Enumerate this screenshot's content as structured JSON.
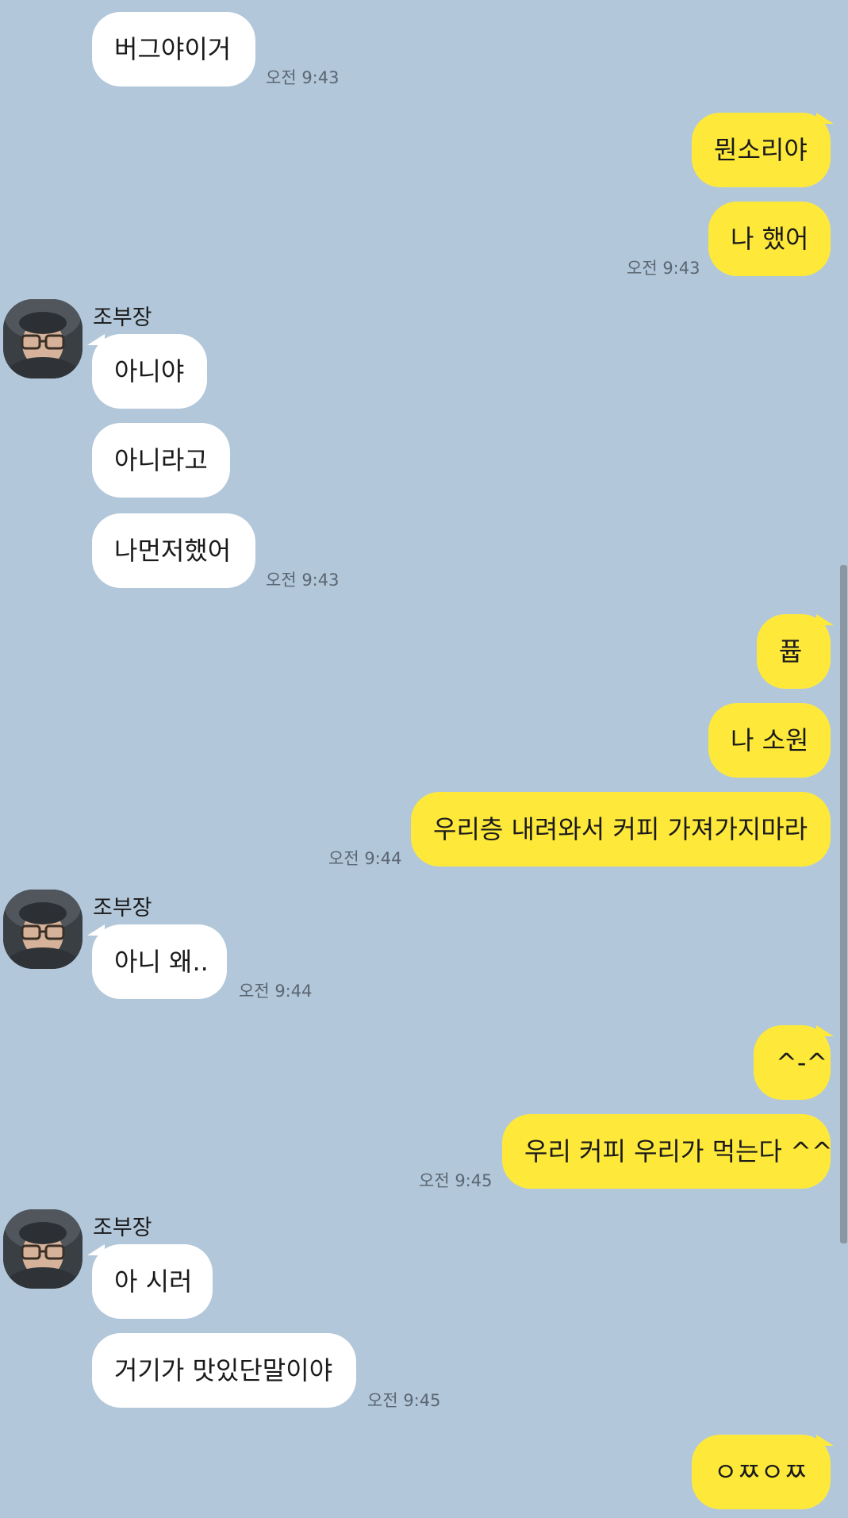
{
  "colors": {
    "background": "#b2c7da",
    "incoming_bubble": "#ffffff",
    "outgoing_bubble": "#fee93b",
    "timestamp": "#5b6672"
  },
  "messages": [
    {
      "dir": "in",
      "text": "버그야이거"
    },
    {
      "dir": "in",
      "time": "오전 9:43"
    },
    {
      "dir": "out",
      "text": "뭔소리야"
    },
    {
      "dir": "out",
      "text": "나 했어"
    },
    {
      "dir": "out",
      "time": "오전 9:43"
    },
    {
      "sender": "조부장"
    },
    {
      "dir": "in",
      "text": "아니야"
    },
    {
      "dir": "in",
      "text": "아니라고"
    },
    {
      "dir": "in",
      "text": "나먼저했어"
    },
    {
      "dir": "in",
      "time": "오전 9:43"
    },
    {
      "dir": "out",
      "text": "퓹"
    },
    {
      "dir": "out",
      "text": "나 소원"
    },
    {
      "dir": "out",
      "text": "우리층 내려와서 커피 가져가지마라"
    },
    {
      "dir": "out",
      "time": "오전 9:44"
    },
    {
      "sender": "조부장"
    },
    {
      "dir": "in",
      "text": "아니 왜.."
    },
    {
      "dir": "in",
      "time": "오전 9:44"
    },
    {
      "dir": "out",
      "text": "^-^"
    },
    {
      "dir": "out",
      "text": "우리 커피 우리가 먹는다 ^^"
    },
    {
      "dir": "out",
      "time": "오전 9:45"
    },
    {
      "sender": "조부장"
    },
    {
      "dir": "in",
      "text": "아 시러"
    },
    {
      "dir": "in",
      "text": "거기가 맛있단말이야"
    },
    {
      "dir": "in",
      "time": "오전 9:45"
    },
    {
      "dir": "out",
      "text": "ㅇㅉㅇㅉ"
    }
  ]
}
